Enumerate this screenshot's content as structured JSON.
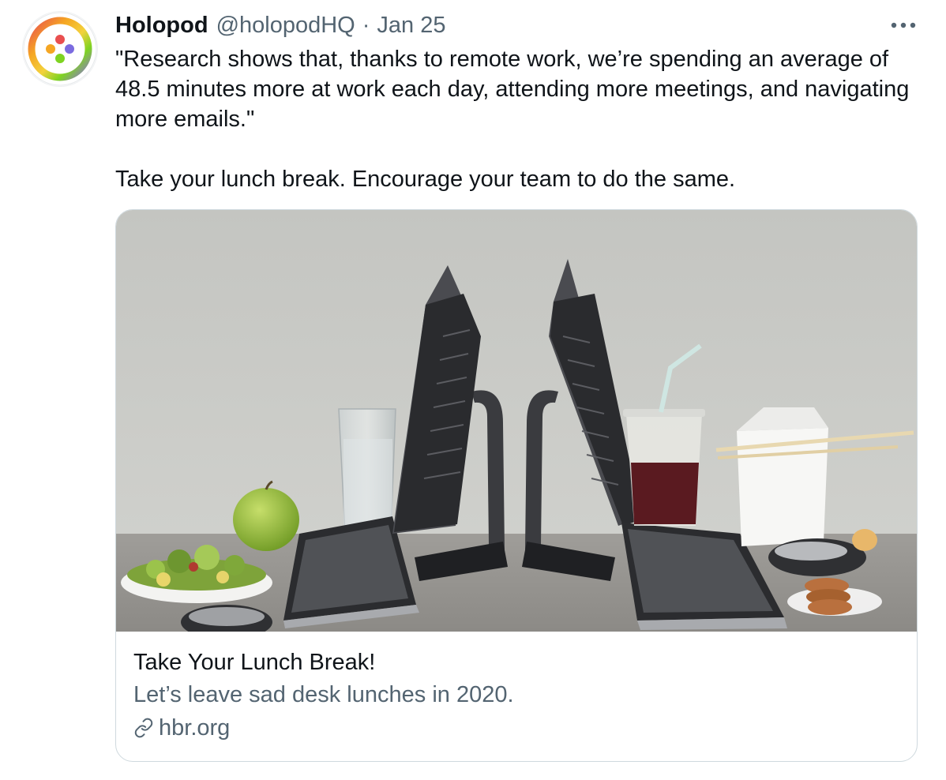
{
  "tweet": {
    "author_name": "Holopod",
    "author_handle": "@holopodHQ",
    "separator": "·",
    "date": "Jan 25",
    "text_line1": "\"Research shows that, thanks to remote work, we’re spending an average of 48.5 minutes more at work each day, attending more meetings, and navigating more emails.\"",
    "text_line2": "Take your lunch break. Encourage your team to do the same."
  },
  "link_card": {
    "title": "Take Your Lunch Break!",
    "description": "Let’s leave sad desk lunches in 2020.",
    "domain": "hbr.org"
  },
  "icons": {
    "more": "more-horizontal-icon",
    "link": "link-icon",
    "avatar": "holopod-logo"
  },
  "colors": {
    "text_primary": "#0f1419",
    "text_secondary": "#536471",
    "card_border": "#cfd9de"
  }
}
